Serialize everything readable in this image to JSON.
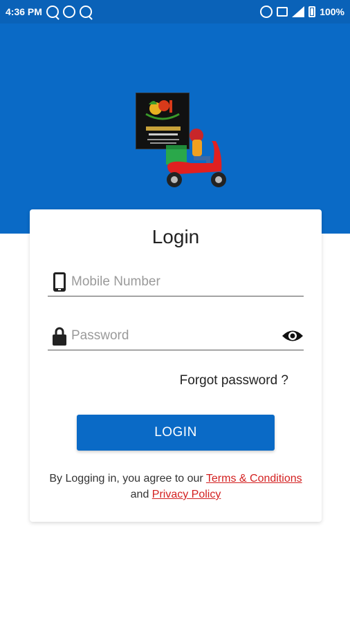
{
  "status_bar": {
    "time": "4:36 PM",
    "battery": "100%",
    "left_icons": [
      "q-app-icon",
      "whatsapp-icon",
      "q-app-icon"
    ],
    "right_icons": [
      "alarm-icon",
      "volte-icon",
      "signal-icon",
      "battery-icon"
    ]
  },
  "header": {
    "logo": "foodie-court-logo",
    "illustration": "delivery-scooter-rider"
  },
  "login_card": {
    "title": "Login",
    "mobile_placeholder": "Mobile Number",
    "password_placeholder": "Password",
    "forgot_label": "Forgot password ?",
    "login_button": "LOGIN",
    "terms_prefix": "By Logging in, you agree to our ",
    "terms_link": "Terms & Conditions",
    "terms_and": " and ",
    "privacy_link": "Privacy Policy"
  },
  "colors": {
    "primary": "#0a6ac6",
    "link": "#d32020"
  }
}
